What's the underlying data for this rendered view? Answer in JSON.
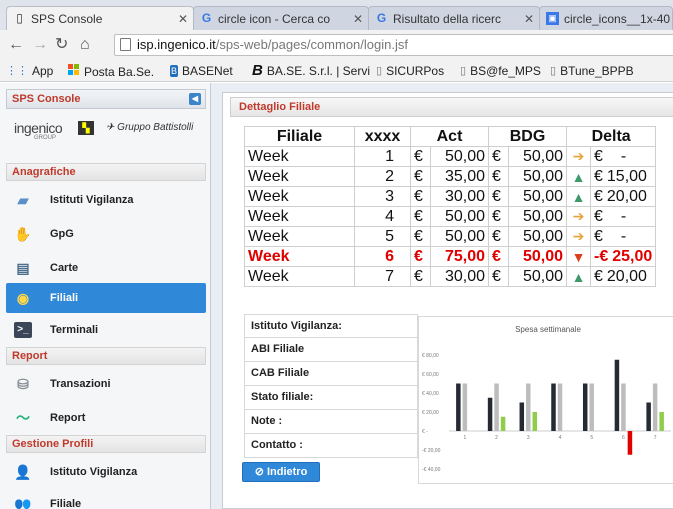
{
  "browser": {
    "tabs": [
      {
        "label": "SPS Console",
        "icon": "page-icon",
        "active": true
      },
      {
        "label": "circle icon - Cerca co",
        "icon": "google-icon",
        "active": false
      },
      {
        "label": "Risultato della ricerc",
        "icon": "google-icon",
        "active": false
      },
      {
        "label": "circle_icons__1x-40",
        "icon": "image-icon",
        "active": false
      }
    ],
    "url_host": "isp.ingenico.it",
    "url_path": "/sps-web/pages/common/login.jsf",
    "bookmarks": [
      {
        "label": "App",
        "icon": "apps-grid-icon"
      },
      {
        "label": "Posta Ba.Se.",
        "icon": "windows-icon"
      },
      {
        "label": "BASENet",
        "icon": "basenet-icon"
      },
      {
        "label": "BA.SE. S.r.l. | Servi",
        "icon": "b-icon"
      },
      {
        "label": "SICURPos",
        "icon": "page-icon"
      },
      {
        "label": "BS@fe_MPS",
        "icon": "page-icon"
      },
      {
        "label": "BTune_BPPB",
        "icon": "page-icon"
      }
    ]
  },
  "sidebar": {
    "title": "SPS Console",
    "logo_text": "ingenico",
    "logo_sub": "GROUP",
    "gruppo": "Gruppo Battistolli",
    "sections": [
      {
        "label": "Anagrafiche",
        "items": [
          {
            "label": "Istituti Vigilanza",
            "icon": "monitor-icon"
          },
          {
            "label": "GpG",
            "icon": "guard-icon"
          },
          {
            "label": "Carte",
            "icon": "card-icon"
          },
          {
            "label": "Filiali",
            "icon": "branch-icon",
            "active": true
          },
          {
            "label": "Terminali",
            "icon": "terminal-icon"
          }
        ]
      },
      {
        "label": "Report",
        "items": [
          {
            "label": "Transazioni",
            "icon": "database-icon"
          },
          {
            "label": "Report",
            "icon": "pulse-icon"
          }
        ]
      },
      {
        "label": "Gestione Profili",
        "items": [
          {
            "label": "Istituto Vigilanza",
            "icon": "user-icon"
          },
          {
            "label": "Filiale",
            "icon": "users-icon"
          }
        ]
      }
    ]
  },
  "panel": {
    "title": "Dettaglio Filiale",
    "back_label": "Indietro"
  },
  "table": {
    "headers": [
      "Filiale",
      "xxxx",
      "Act",
      "BDG",
      "Delta"
    ],
    "rows": [
      {
        "filiale": "Week",
        "n": "1",
        "cur1": "€",
        "act": "50,00",
        "cur2": "€",
        "bdg": "50,00",
        "icon": "arrow-right-icon",
        "dcur": "€",
        "delta": "-"
      },
      {
        "filiale": "Week",
        "n": "2",
        "cur1": "€",
        "act": "35,00",
        "cur2": "€",
        "bdg": "50,00",
        "icon": "arrow-up-icon",
        "dcur": "€",
        "delta": "15,00"
      },
      {
        "filiale": "Week",
        "n": "3",
        "cur1": "€",
        "act": "30,00",
        "cur2": "€",
        "bdg": "50,00",
        "icon": "arrow-up-icon",
        "dcur": "€",
        "delta": "20,00"
      },
      {
        "filiale": "Week",
        "n": "4",
        "cur1": "€",
        "act": "50,00",
        "cur2": "€",
        "bdg": "50,00",
        "icon": "arrow-right-icon",
        "dcur": "€",
        "delta": "-"
      },
      {
        "filiale": "Week",
        "n": "5",
        "cur1": "€",
        "act": "50,00",
        "cur2": "€",
        "bdg": "50,00",
        "icon": "arrow-right-icon",
        "dcur": "€",
        "delta": "-"
      },
      {
        "filiale": "Week",
        "n": "6",
        "cur1": "€",
        "act": "75,00",
        "cur2": "€",
        "bdg": "50,00",
        "icon": "arrow-down-icon",
        "dcur": "-€",
        "delta": "25,00",
        "highlight": true
      },
      {
        "filiale": "Week",
        "n": "7",
        "cur1": "€",
        "act": "30,00",
        "cur2": "€",
        "bdg": "50,00",
        "icon": "arrow-up-icon",
        "dcur": "€",
        "delta": "20,00"
      }
    ]
  },
  "info_fields": [
    "Istituto Vigilanza:",
    "ABI Filiale",
    "CAB Filiale",
    "Stato filiale:",
    "Note :",
    "Contatto :"
  ],
  "colors": {
    "accent": "#2f88d8",
    "section_text": "#c0392b",
    "highlight": "#e00000"
  },
  "chart_data": {
    "type": "bar",
    "title": "Spesa settimanale",
    "categories": [
      "1",
      "2",
      "3",
      "4",
      "5",
      "6",
      "7"
    ],
    "series": [
      {
        "values": [
          50,
          35,
          30,
          50,
          50,
          75,
          30
        ],
        "color": "#262a33"
      },
      {
        "values": [
          50,
          50,
          50,
          50,
          50,
          50,
          50
        ],
        "color": "#bdbdbd"
      },
      {
        "values": [
          0,
          15,
          20,
          0,
          0,
          -25,
          20
        ],
        "color": "#8fcd4a",
        "negative_color": "#e00000"
      }
    ],
    "ylim": [
      -40,
      80
    ],
    "yticks": [
      -40,
      -20,
      0,
      20,
      40,
      60,
      80
    ],
    "ytick_labels": [
      "-€ 40,00",
      "-€ 20,00",
      "€ -",
      "€ 20,00",
      "€ 40,00",
      "€ 60,00",
      "€ 80,00"
    ],
    "xlabel": "",
    "ylabel": "",
    "grid": false,
    "legend": "none"
  }
}
